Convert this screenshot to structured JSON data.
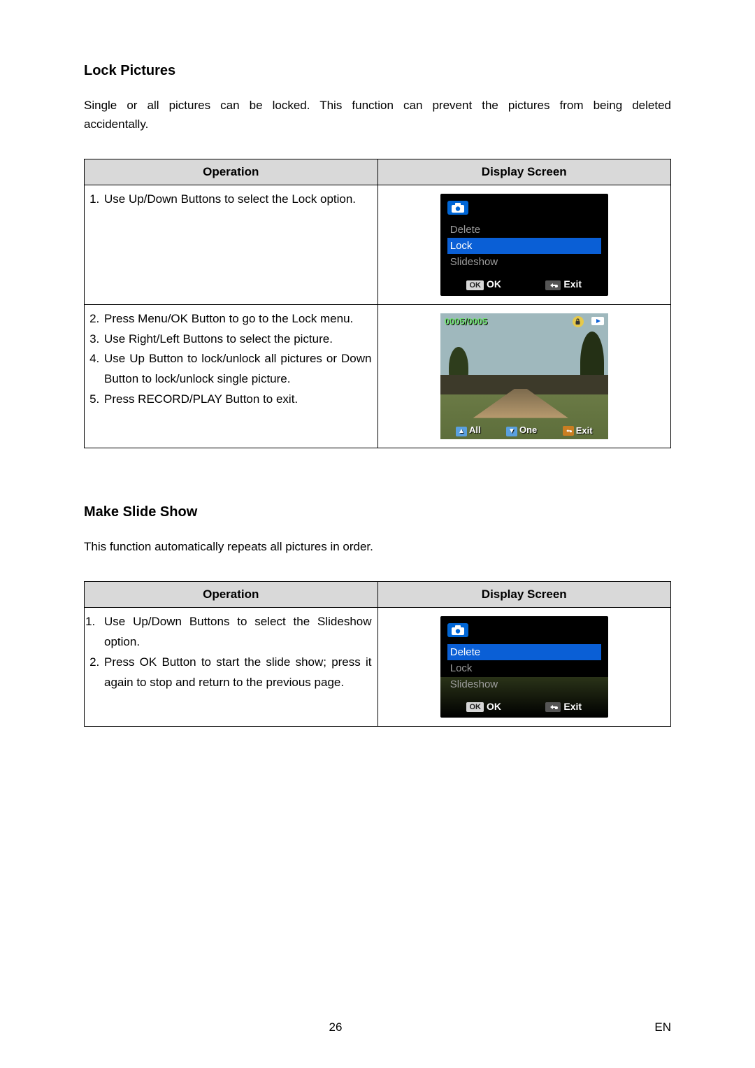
{
  "sections": {
    "lock": {
      "title": "Lock Pictures",
      "intro": "Single or all pictures can be locked. This function can prevent the pictures from being deleted accidentally.",
      "table": {
        "headers": {
          "operation": "Operation",
          "display": "Display Screen"
        },
        "rows": [
          {
            "steps": [
              "Use Up/Down Buttons to select the Lock option."
            ],
            "screen": {
              "type": "menu",
              "menu_items": [
                "Delete",
                "Lock",
                "Slideshow"
              ],
              "selected_index": 1,
              "footer_ok_chip": "OK",
              "footer_ok_text": "OK",
              "footer_exit_text": "Exit"
            }
          },
          {
            "start": 2,
            "steps": [
              "Press Menu/OK Button to go to the Lock menu.",
              "Use Right/Left Buttons to select the picture.",
              "Use Up Button to lock/unlock all pictures or Down Button to lock/unlock single picture.",
              "Press RECORD/PLAY Button to exit."
            ],
            "screen": {
              "type": "photo",
              "counter": "0005/0005",
              "bottom_all": "All",
              "bottom_one": "One",
              "bottom_exit": "Exit"
            }
          }
        ]
      }
    },
    "slideshow": {
      "title": "Make Slide Show",
      "intro": "This function automatically repeats all pictures in order.",
      "table": {
        "headers": {
          "operation": "Operation",
          "display": "Display Screen"
        },
        "rows": [
          {
            "steps": [
              "Use Up/Down Buttons to select the Slideshow option.",
              "Press OK Button to start the slide show; press it again to stop and return to the previous page."
            ],
            "screen": {
              "type": "menu-slide",
              "menu_items": [
                "Delete",
                "Lock",
                "Slideshow"
              ],
              "selected_index": 0,
              "footer_ok_chip": "OK",
              "footer_ok_text": "OK",
              "footer_exit_text": "Exit"
            }
          }
        ]
      }
    }
  },
  "footer": {
    "page_number": "26",
    "language": "EN"
  },
  "icons": {
    "camera": "camera-icon",
    "return": "return-icon",
    "lock": "lock-icon",
    "play": "play-icon",
    "up": "▲",
    "down": "▼"
  }
}
